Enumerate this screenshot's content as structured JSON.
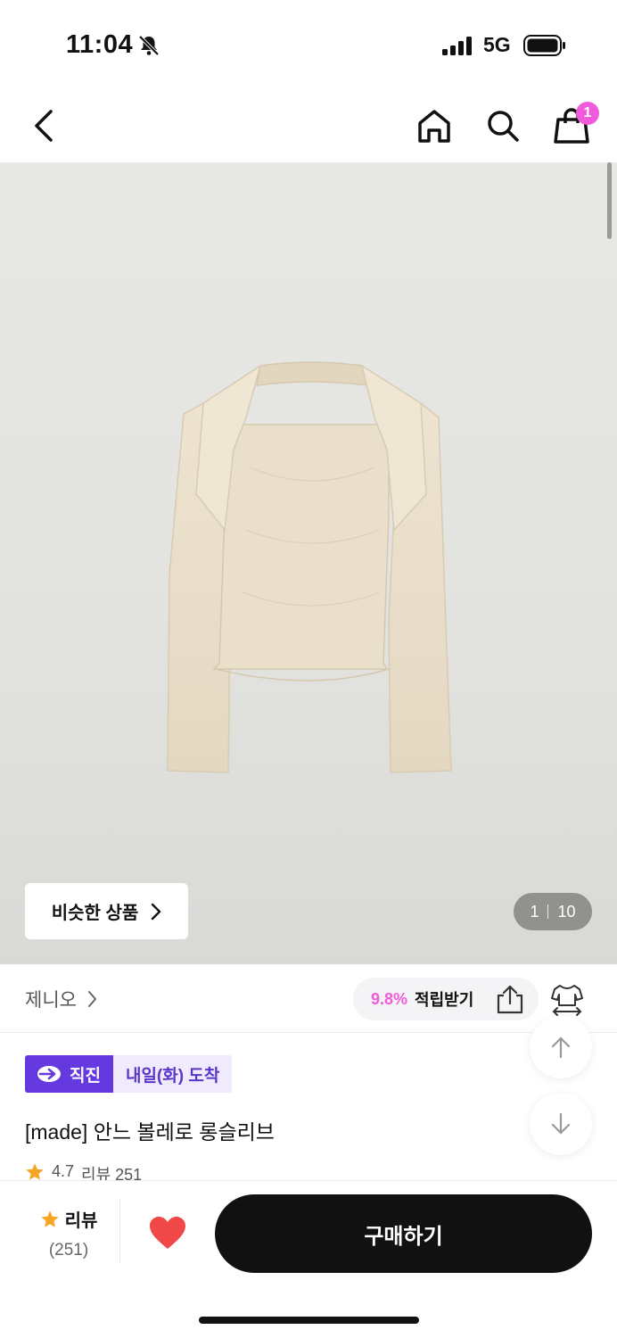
{
  "status_bar": {
    "time": "11:04",
    "network": "5G"
  },
  "nav": {
    "cart_count": "1"
  },
  "hero": {
    "similar_label": "비슷한 상품",
    "page_current": "1",
    "page_total": "10"
  },
  "brand": {
    "name": "제니오",
    "reward_percent": "9.8%",
    "reward_label": "적립받기"
  },
  "delivery": {
    "direct_label": "직진",
    "arrival_label": "내일(화) 도착"
  },
  "product": {
    "title": "[made] 안느 볼레로 롱슬리브",
    "rating": "4.7",
    "review_text": "리뷰 251"
  },
  "bottom_bar": {
    "review_label": "리뷰",
    "review_count": "(251)",
    "buy_label": "구매하기"
  },
  "colors": {
    "accent_pink": "#f05bdc",
    "direct_purple": "#6638e0",
    "arrival_bg": "#efeafc",
    "heart_red": "#f04848",
    "star_orange": "#f5a524"
  },
  "icons": [
    "back-icon",
    "home-icon",
    "search-icon",
    "cart-icon",
    "share-icon",
    "size-guide-icon",
    "arrow-up-icon",
    "arrow-down-icon",
    "star-icon",
    "heart-icon",
    "bell-off-icon",
    "signal-icon",
    "battery-icon"
  ]
}
